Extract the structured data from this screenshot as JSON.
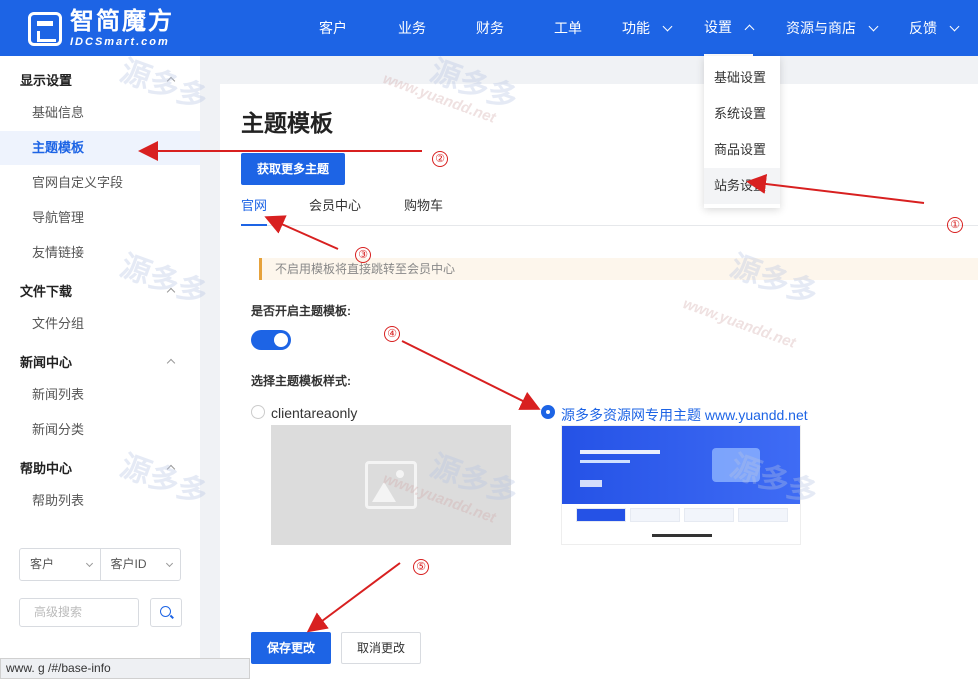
{
  "brand": {
    "name_cn": "智简魔方",
    "name_en": "IDCSmart.com"
  },
  "nav": {
    "items": [
      {
        "label": "客户"
      },
      {
        "label": "业务"
      },
      {
        "label": "财务"
      },
      {
        "label": "工单"
      },
      {
        "label": "功能"
      },
      {
        "label": "设置"
      },
      {
        "label": "资源与商店"
      },
      {
        "label": "反馈"
      }
    ],
    "dropdown": [
      "基础设置",
      "系统设置",
      "商品设置",
      "站务设置"
    ]
  },
  "sidebar": {
    "groups": [
      {
        "title": "显示设置",
        "items": [
          "基础信息",
          "主题模板",
          "官网自定义字段",
          "导航管理",
          "友情链接"
        ]
      },
      {
        "title": "文件下载",
        "items": [
          "文件分组"
        ]
      },
      {
        "title": "新闻中心",
        "items": [
          "新闻列表",
          "新闻分类"
        ]
      },
      {
        "title": "帮助中心",
        "items": [
          "帮助列表"
        ]
      }
    ],
    "filter_type": "客户",
    "filter_field": "客户ID",
    "search_placeholder": "高级搜索"
  },
  "main": {
    "title": "主题模板",
    "more_button": "获取更多主题",
    "tabs": [
      "官网",
      "会员中心",
      "购物车"
    ],
    "notice": "不启用模板将直接跳转至会员中心",
    "enable_label": "是否开启主题模板:",
    "style_label": "选择主题模板样式:",
    "options": [
      {
        "label": "clientareaonly",
        "selected": false
      },
      {
        "label": "源多多资源网专用主题 www.yuandd.net",
        "selected": true
      }
    ],
    "save_button": "保存更改",
    "cancel_button": "取消更改"
  },
  "annotations": [
    "①",
    "②",
    "③",
    "④",
    "⑤"
  ],
  "watermark": {
    "text": "源多多",
    "url": "www.yuandd.net"
  },
  "statusbar": "www.  g   /#/base-info",
  "colors": {
    "primary": "#1d64e5",
    "annotation": "#d82020"
  }
}
